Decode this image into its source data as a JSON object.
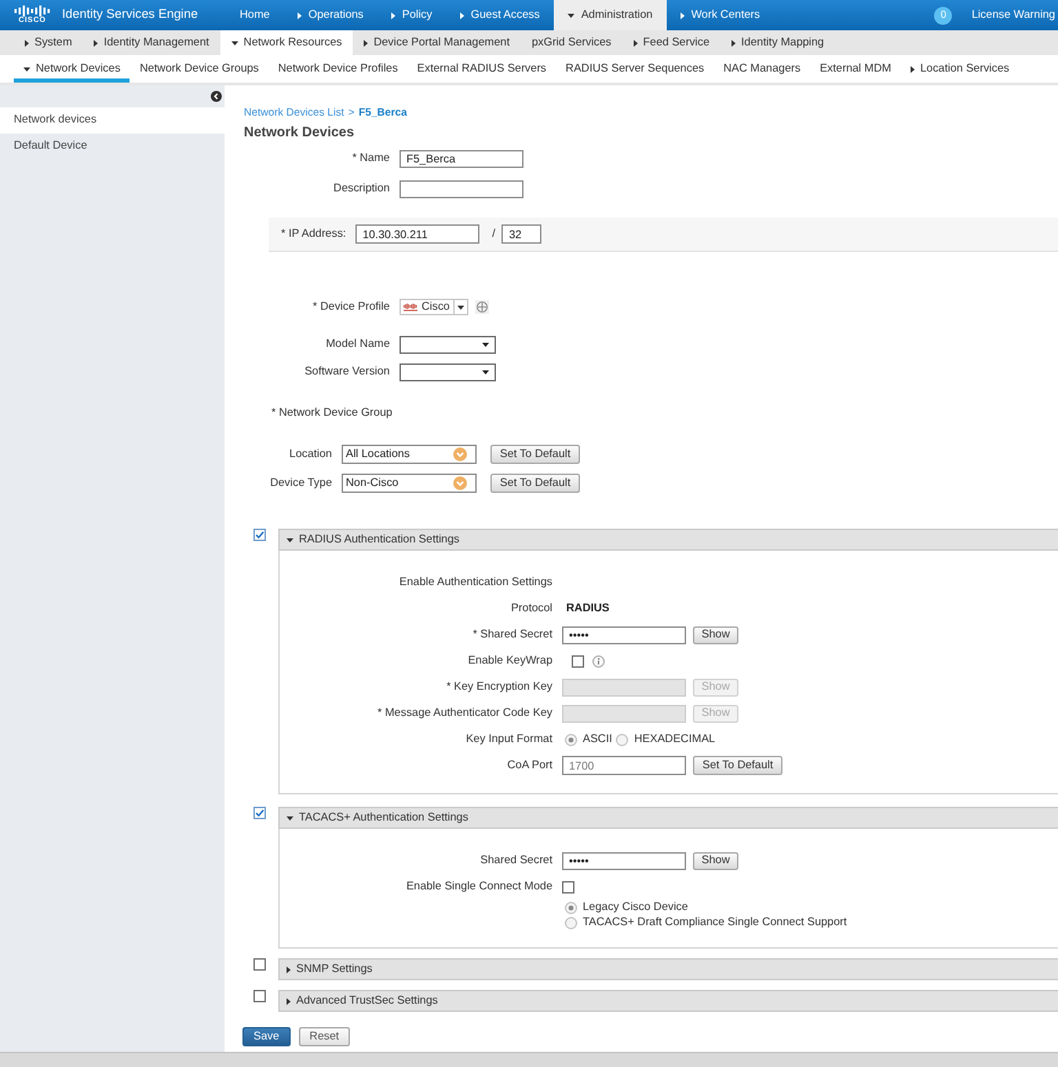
{
  "header": {
    "logo": "CISCO",
    "product": "Identity Services Engine",
    "nav": [
      {
        "label": "Home",
        "kind": "link",
        "expanded": false,
        "selected": false
      },
      {
        "label": "Operations",
        "kind": "menu",
        "expanded": false,
        "selected": false
      },
      {
        "label": "Policy",
        "kind": "menu",
        "expanded": false,
        "selected": false
      },
      {
        "label": "Guest Access",
        "kind": "menu",
        "expanded": false,
        "selected": false
      },
      {
        "label": "Administration",
        "kind": "menu",
        "expanded": true,
        "selected": true
      },
      {
        "label": "Work Centers",
        "kind": "menu",
        "expanded": false,
        "selected": false
      }
    ],
    "notifications": "0",
    "license": "License Warning"
  },
  "subnav": [
    {
      "label": "System",
      "kind": "menu",
      "expanded": false,
      "selected": false
    },
    {
      "label": "Identity Management",
      "kind": "menu",
      "expanded": false,
      "selected": false
    },
    {
      "label": "Network Resources",
      "kind": "menu",
      "expanded": true,
      "selected": true
    },
    {
      "label": "Device Portal Management",
      "kind": "menu",
      "expanded": false,
      "selected": false
    },
    {
      "label": "pxGrid Services",
      "kind": "link",
      "expanded": false,
      "selected": false
    },
    {
      "label": "Feed Service",
      "kind": "menu",
      "expanded": false,
      "selected": false
    },
    {
      "label": "Identity Mapping",
      "kind": "menu",
      "expanded": false,
      "selected": false
    }
  ],
  "tabs": [
    {
      "label": "Network Devices",
      "kind": "menu",
      "expanded": true,
      "selected": true
    },
    {
      "label": "Network Device Groups",
      "kind": "link",
      "expanded": false,
      "selected": false
    },
    {
      "label": "Network Device Profiles",
      "kind": "link",
      "expanded": false,
      "selected": false
    },
    {
      "label": "External RADIUS Servers",
      "kind": "link",
      "expanded": false,
      "selected": false
    },
    {
      "label": "RADIUS Server Sequences",
      "kind": "link",
      "expanded": false,
      "selected": false
    },
    {
      "label": "NAC Managers",
      "kind": "link",
      "expanded": false,
      "selected": false
    },
    {
      "label": "External MDM",
      "kind": "link",
      "expanded": false,
      "selected": false
    },
    {
      "label": "Location Services",
      "kind": "menu",
      "expanded": false,
      "selected": false
    }
  ],
  "sidebar": {
    "items": [
      {
        "label": "Network devices",
        "selected": true
      },
      {
        "label": "Default Device",
        "selected": false
      }
    ]
  },
  "breadcrumb": {
    "link": "Network Devices List",
    "separator": ">",
    "current": "F5_Berca"
  },
  "title": "Network Devices",
  "device": {
    "name": {
      "label": "* Name",
      "value": "F5_Berca"
    },
    "description": {
      "label": "Description"
    },
    "ip_address": {
      "label": "* IP Address:",
      "value": "10.30.30.211",
      "separator": "/",
      "mask": "32"
    },
    "device_profile": {
      "label": "* Device Profile",
      "value": "Cisco"
    },
    "model_name": {
      "label": "Model Name"
    },
    "software_version": {
      "label": "Software Version"
    }
  },
  "network_device_group": {
    "label": "* Network Device Group",
    "rows": [
      {
        "label": "Location",
        "value": "All Locations",
        "button": "Set To Default"
      },
      {
        "label": "Device Type",
        "value": "Non-Cisco",
        "button": "Set To Default"
      }
    ]
  },
  "sections": [
    {
      "title": "RADIUS Authentication Settings",
      "checked": true,
      "expanded": true,
      "rows": [
        {
          "kind": "heading",
          "label": "Enable Authentication Settings"
        },
        {
          "kind": "static",
          "label": "Protocol",
          "value": "RADIUS"
        },
        {
          "kind": "secret",
          "label": "* Shared Secret",
          "value": "•••••",
          "button": "Show",
          "disabled": false
        },
        {
          "kind": "checkbox",
          "label": "Enable KeyWrap",
          "checked": false,
          "info": true
        },
        {
          "kind": "secret",
          "label": "* Key Encryption Key",
          "button": "Show",
          "disabled": true
        },
        {
          "kind": "secret",
          "label": "* Message Authenticator Code Key",
          "button": "Show",
          "disabled": true
        },
        {
          "kind": "radio",
          "label": "Key Input Format",
          "options": [
            {
              "label": "ASCII",
              "selected": true
            },
            {
              "label": "HEXADECIMAL",
              "selected": false
            }
          ]
        },
        {
          "kind": "text",
          "label": "CoA Port",
          "value": "1700",
          "button": "Set To Default"
        }
      ]
    },
    {
      "title": "TACACS+ Authentication Settings",
      "checked": true,
      "expanded": true,
      "rows": [
        {
          "kind": "secret",
          "label": "Shared Secret",
          "value": "•••••",
          "button": "Show",
          "disabled": false
        },
        {
          "kind": "checkbox",
          "label": "Enable Single Connect Mode",
          "checked": false,
          "info": false
        },
        {
          "kind": "options",
          "options": [
            {
              "label": "Legacy Cisco Device",
              "selected": true
            },
            {
              "label": "TACACS+ Draft Compliance Single Connect Support",
              "selected": false
            }
          ]
        }
      ]
    },
    {
      "title": "SNMP Settings",
      "checked": false,
      "expanded": false
    },
    {
      "title": "Advanced TrustSec Settings",
      "checked": false,
      "expanded": false
    }
  ],
  "actions": [
    {
      "label": "Save",
      "kind": "primary"
    },
    {
      "label": "Reset",
      "kind": "secondary"
    }
  ]
}
